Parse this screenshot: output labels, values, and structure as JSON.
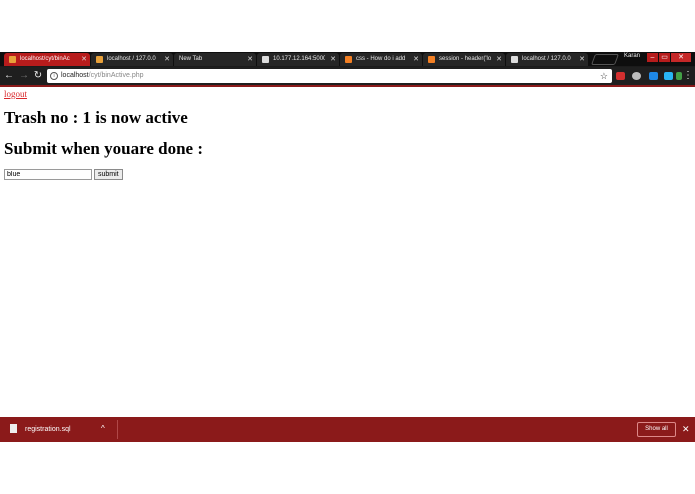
{
  "browser": {
    "tabs": [
      {
        "title": "localhost/cyt/binAc",
        "active": true,
        "favicon_color": "#e8a13a"
      },
      {
        "title": "localhost / 127.0.0",
        "active": false,
        "favicon_color": "#e8a13a"
      },
      {
        "title": "New Tab",
        "active": false,
        "favicon_color": ""
      },
      {
        "title": "10.177.12.164:5000",
        "active": false,
        "favicon_color": "#dddddd"
      },
      {
        "title": "css - How do i add",
        "active": false,
        "favicon_color": "#f48024"
      },
      {
        "title": "session - header('lo",
        "active": false,
        "favicon_color": "#f48024"
      },
      {
        "title": "localhost / 127.0.0",
        "active": false,
        "favicon_color": "#dddddd"
      }
    ],
    "profile_name": "Karan",
    "window_controls": {
      "minimize": "–",
      "restore": "▭",
      "close": "✕"
    },
    "nav": {
      "back": "←",
      "forward": "→",
      "reload": "↻"
    },
    "url": {
      "host": "localhost",
      "path": "/cyt/binActive.php"
    },
    "info_icon": "i",
    "star_icon": "☆",
    "menu_icon": "⋮",
    "extensions": [
      {
        "name": "adblock-icon",
        "color": "#d32f2f"
      },
      {
        "name": "extension-gray-icon",
        "color": "#bdbdbd"
      },
      {
        "name": "s-extension-icon",
        "color": "#1e88e5"
      },
      {
        "name": "cloud-extension-icon",
        "color": "#29b6f6"
      },
      {
        "name": "green-extension-icon",
        "color": "#43a047"
      }
    ],
    "accent_color": "#b71c1c"
  },
  "page": {
    "logout_label": "logout",
    "status_heading": "Trash no : 1 is now active",
    "prompt_heading": "Submit when youare done :",
    "input_value": "blue",
    "submit_label": "submit"
  },
  "download_bar": {
    "file_name": "registration.sql",
    "caret": "^",
    "show_all_label": "Show all",
    "close_icon": "✕",
    "bar_color": "#8b1a1a"
  }
}
